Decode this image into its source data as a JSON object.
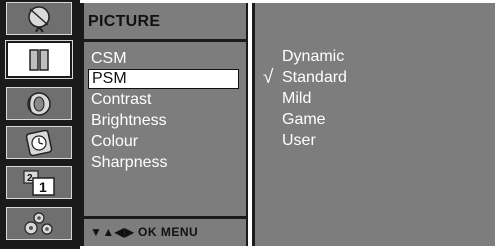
{
  "menu": {
    "title": "PICTURE",
    "items": [
      {
        "label": "CSM"
      },
      {
        "label": "PSM"
      },
      {
        "label": "Contrast"
      },
      {
        "label": "Brightness"
      },
      {
        "label": "Colour"
      },
      {
        "label": "Sharpness"
      }
    ],
    "selected_index": 1,
    "nav_hint": "▼▲◀▶ OK MENU"
  },
  "options": {
    "items": [
      {
        "label": "Dynamic"
      },
      {
        "label": "Standard"
      },
      {
        "label": "Mild"
      },
      {
        "label": "Game"
      },
      {
        "label": "User"
      }
    ],
    "checked_index": 1,
    "check_mark": "√"
  },
  "icons": [
    {
      "name": "satellite-dish-icon"
    },
    {
      "name": "picture-book-icon"
    },
    {
      "name": "speaker-icon"
    },
    {
      "name": "clock-icon"
    },
    {
      "name": "input-source-icon",
      "label": "1"
    },
    {
      "name": "settings-gears-icon"
    }
  ],
  "colors": {
    "panel_gray": "#7d7d7d",
    "frame_dark": "#1a1a1a",
    "text_white": "#ffffff"
  }
}
